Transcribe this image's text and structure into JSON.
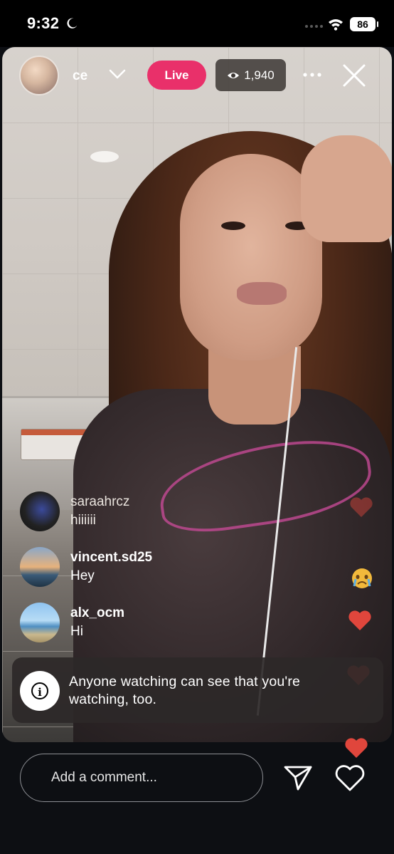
{
  "status_bar": {
    "time": "9:32",
    "battery": "86",
    "icons": [
      "moon-icon",
      "signal-icon",
      "wifi-icon",
      "battery-icon"
    ]
  },
  "header": {
    "username": "ce",
    "live_label": "Live",
    "viewer_count": "1,940",
    "icons": [
      "chevron-down-icon",
      "eye-icon",
      "more-icon",
      "close-icon"
    ]
  },
  "comments": [
    {
      "username": "saraahrcz",
      "text": "hiiiiii"
    },
    {
      "username": "vincent.sd25",
      "text": "Hey"
    },
    {
      "username": "alx_ocm",
      "text": "Hi"
    }
  ],
  "notice": {
    "text": "Anyone watching can see that you're watching, too.",
    "icon": "info-icon"
  },
  "composer": {
    "placeholder": "Add a comment...",
    "icons": [
      "send-icon",
      "heart-icon"
    ]
  },
  "colors": {
    "live_badge": "#e9306a",
    "heart": "#e0463c",
    "background": "#0d0f13"
  }
}
